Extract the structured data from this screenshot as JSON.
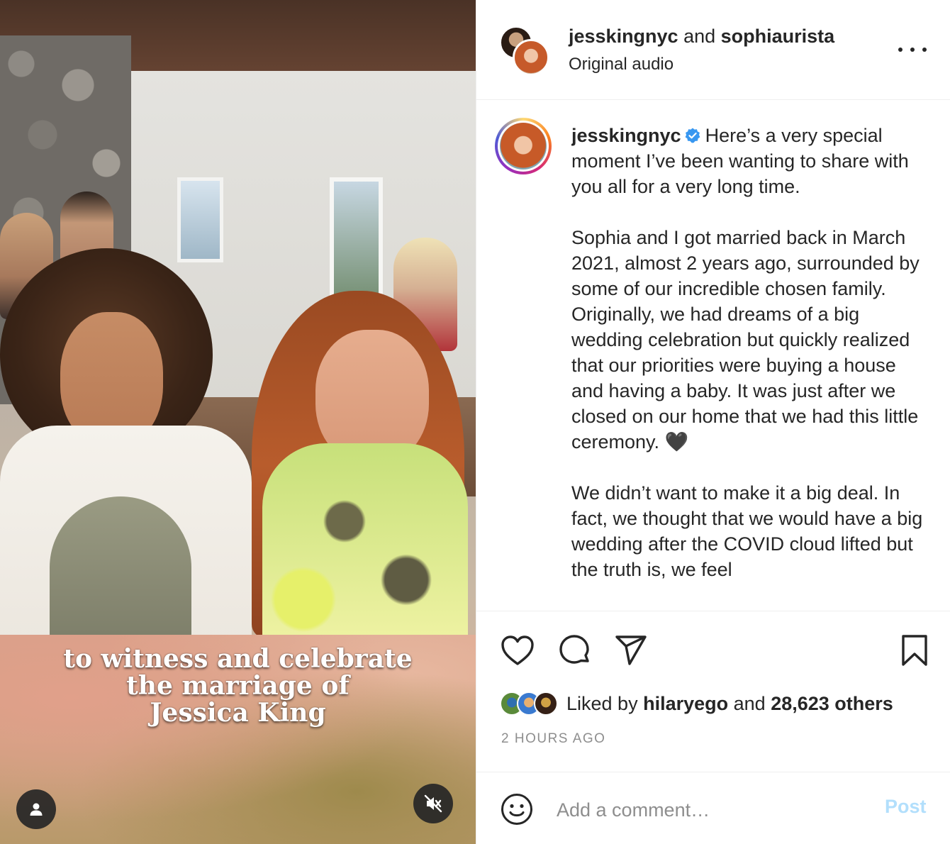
{
  "video": {
    "caption_lines": [
      "to witness and celebrate",
      "the marriage of",
      "Jessica King"
    ]
  },
  "header": {
    "user1": "jesskingnyc",
    "connector": " and ",
    "user2": "sophiaurista",
    "audio": "Original audio"
  },
  "post": {
    "username": "jesskingnyc",
    "paragraphs": [
      "Here’s a very special moment I’ve been wanting to share with you all for a very long time.",
      "Sophia and I got married back in March 2021, almost 2 years ago, surrounded by some of our incredible chosen family. Originally, we had dreams of a big wedding celebration but quickly realized that our priorities were buying a house and having a baby. It was just after we closed on our home that we had this little ceremony.",
      "We didn’t want to make it a big deal. In fact, we thought that we would have a big wedding after the COVID cloud lifted but the truth is, we feel"
    ],
    "heart_emoji": "🖤"
  },
  "likes": {
    "prefix": "Liked by ",
    "user": "hilaryego",
    "connector": " and ",
    "others": "28,623 others"
  },
  "timestamp": "2 HOURS AGO",
  "comment": {
    "placeholder": "Add a comment…",
    "post_label": "Post"
  },
  "colors": {
    "text": "#262626",
    "muted": "#8e8e8e",
    "verified": "#3897f0",
    "post_button_disabled": "#b2dffc"
  }
}
